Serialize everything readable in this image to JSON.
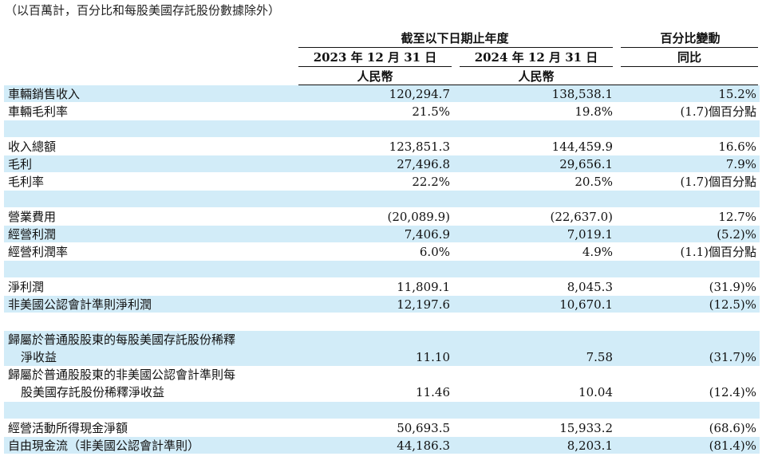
{
  "note": "（以百萬計，百分比和每股美國存託股份數據除外）",
  "header": {
    "period_group": "截至以下日期止年度",
    "change_group": "百分比變動",
    "col1_date": "2023 年 12 月 31 日",
    "col2_date": "2024 年 12 月 31 日",
    "col3_label": "同比",
    "col1_currency": "人民幣",
    "col2_currency": "人民幣"
  },
  "rows": [
    {
      "label": "車輛銷售收入",
      "v2023": "120,294.7",
      "v2024": "138,538.1",
      "yoy": "15.2%"
    },
    {
      "label": "車輛毛利率",
      "v2023": "21.5%",
      "v2024": "19.8%",
      "yoy": "(1.7)個百分點"
    },
    {
      "label": "收入總額",
      "v2023": "123,851.3",
      "v2024": "144,459.9",
      "yoy": "16.6%"
    },
    {
      "label": "毛利",
      "v2023": "27,496.8",
      "v2024": "29,656.1",
      "yoy": "7.9%"
    },
    {
      "label": "毛利率",
      "v2023": "22.2%",
      "v2024": "20.5%",
      "yoy": "(1.7)個百分點"
    },
    {
      "label": "營業費用",
      "v2023": "(20,089.9)",
      "v2024": "(22,637.0)",
      "yoy": "12.7%"
    },
    {
      "label": "經營利潤",
      "v2023": "7,406.9",
      "v2024": "7,019.1",
      "yoy": "(5.2)%"
    },
    {
      "label": "經營利潤率",
      "v2023": "6.0%",
      "v2024": "4.9%",
      "yoy": "(1.1)個百分點"
    },
    {
      "label": "淨利潤",
      "v2023": "11,809.1",
      "v2024": "8,045.3",
      "yoy": "(31.9)%"
    },
    {
      "label": "非美國公認會計準則淨利潤",
      "v2023": "12,197.6",
      "v2024": "10,670.1",
      "yoy": "(12.5)%"
    },
    {
      "label_line1": "歸屬於普通股股東的每股美國存託股份稀釋",
      "label_line2": "淨收益",
      "v2023": "11.10",
      "v2024": "7.58",
      "yoy": "(31.7)%"
    },
    {
      "label_line1": "歸屬於普通股股東的非美國公認會計準則每",
      "label_line2": "股美國存託股份稀釋淨收益",
      "v2023": "11.46",
      "v2024": "10.04",
      "yoy": "(12.4)%"
    },
    {
      "label": "經營活動所得現金淨額",
      "v2023": "50,693.5",
      "v2024": "15,933.2",
      "yoy": "(68.6)%"
    },
    {
      "label": "自由現金流（非美國公認會計準則）",
      "v2023": "44,186.3",
      "v2024": "8,203.1",
      "yoy": "(81.4)%"
    }
  ],
  "colors": {
    "band": "#d2ecf8",
    "text": "#111111"
  }
}
